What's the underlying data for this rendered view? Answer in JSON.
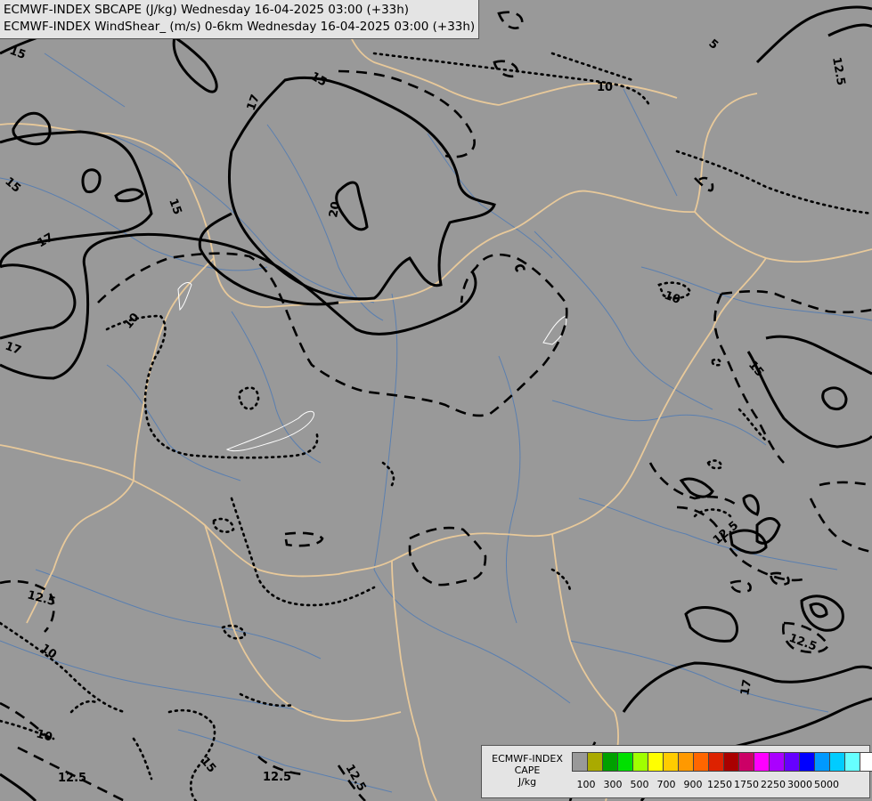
{
  "header": {
    "line1": "ECMWF-INDEX SBCAPE (J/kg) Wednesday 16-04-2025 03:00 (+33h)",
    "line2": "ECMWF-INDEX WindShear_ (m/s) 0-6km Wednesday 16-04-2025 03:00 (+33h)"
  },
  "legend": {
    "title_line1": "ECMWF-INDEX",
    "title_line2": "CAPE",
    "title_line3": "J/kg",
    "swatch_colors": [
      "#999999",
      "#aaaa00",
      "#00a000",
      "#00e000",
      "#a0ff00",
      "#ffff00",
      "#ffcc00",
      "#ff9900",
      "#ff6600",
      "#dd2200",
      "#aa0000",
      "#cc0066",
      "#ff00ff",
      "#aa00ff",
      "#6600ff",
      "#0000ff",
      "#0099ff",
      "#00ccff",
      "#66ffff",
      "#ffffff"
    ],
    "tick_labels": [
      "100",
      "300",
      "500",
      "700",
      "900",
      "1250",
      "1750",
      "2250",
      "3000",
      "5000"
    ]
  },
  "contour_labels": [
    {
      "id": "l-15-a",
      "text": "15"
    },
    {
      "id": "l-15-b",
      "text": "15"
    },
    {
      "id": "l-15-c",
      "text": "15"
    },
    {
      "id": "l-17-a",
      "text": "17"
    },
    {
      "id": "l-17-b",
      "text": "17"
    },
    {
      "id": "l-17-c",
      "text": "17"
    },
    {
      "id": "l-17-d",
      "text": "17"
    },
    {
      "id": "l-20",
      "text": "20"
    },
    {
      "id": "l-15-d",
      "text": "15"
    },
    {
      "id": "l-10-a",
      "text": "10"
    },
    {
      "id": "l-10-b",
      "text": "10"
    },
    {
      "id": "l-10-c",
      "text": "10"
    },
    {
      "id": "l-10-d",
      "text": "10"
    },
    {
      "id": "l-15-e",
      "text": "15"
    },
    {
      "id": "l-15-f",
      "text": "15"
    },
    {
      "id": "l-12-5-a",
      "text": "12.5"
    },
    {
      "id": "l-12-5-b",
      "text": "12.5"
    },
    {
      "id": "l-10-e",
      "text": "10"
    },
    {
      "id": "l-10-f",
      "text": "10"
    },
    {
      "id": "l-12-5-c",
      "text": "12.5"
    },
    {
      "id": "l-12-5-d",
      "text": "12.5"
    },
    {
      "id": "l-12-5-e",
      "text": "12.5"
    },
    {
      "id": "l-10-g",
      "text": "10"
    },
    {
      "id": "l-12-5-f",
      "text": "12.5"
    },
    {
      "id": "l-5",
      "text": "5"
    },
    {
      "id": "l-10-h",
      "text": "10"
    }
  ]
}
